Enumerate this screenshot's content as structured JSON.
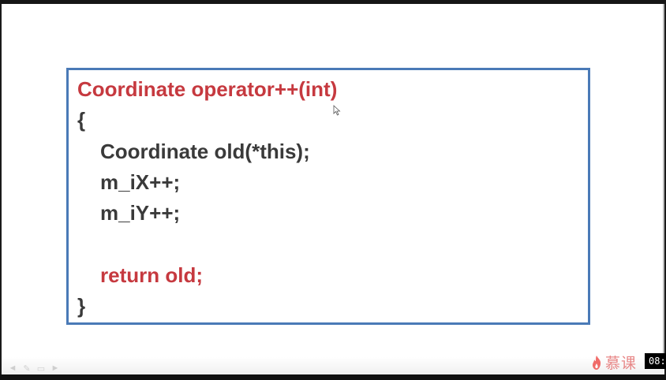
{
  "slide": {
    "code_lines": [
      "Coordinate operator++(int)",
      "{",
      "Coordinate old(*this);",
      "m_iX++;",
      "m_iY++;",
      "",
      "return old;",
      "}"
    ]
  },
  "branding": {
    "logo_text": "慕课"
  },
  "player": {
    "time": "08:"
  },
  "colors": {
    "keyword_red": "#c6393f",
    "code_gray": "#3a3a3a",
    "box_border": "#4a7ab7"
  },
  "icons": {
    "cursor": "mouse-pointer-icon",
    "controls": [
      "prev-icon",
      "pen-icon",
      "screen-icon",
      "next-icon"
    ],
    "logo": "flame-icon"
  }
}
